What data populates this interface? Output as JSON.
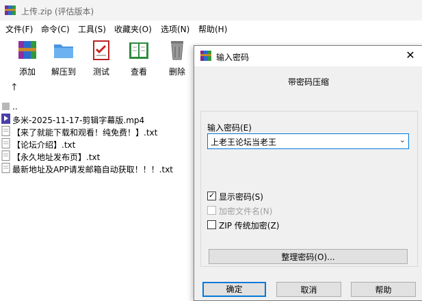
{
  "window": {
    "title": "上传.zip (评估版本)"
  },
  "menu": [
    "文件(F)",
    "命令(C)",
    "工具(S)",
    "收藏夹(O)",
    "选项(N)",
    "帮助(H)"
  ],
  "toolbar": {
    "add": "添加",
    "extract": "解压到",
    "test": "测试",
    "view": "查看",
    "delete": "删除"
  },
  "files": [
    "..",
    "多米-2025-11-17-剪辑字幕版.mp4",
    "【来了就能下载和观看！纯免费！】.txt",
    "【论坛介绍】.txt",
    "【永久地址发布页】.txt",
    "最新地址及APP请发邮箱自动获取！！！.txt"
  ],
  "dialog": {
    "title": "输入密码",
    "subtitle": "带密码压缩",
    "password_label": "输入密码(E)",
    "password_value": "上老王论坛当老王",
    "show_password": "显示密码(S)",
    "encrypt_filenames": "加密文件名(N)",
    "zip_legacy": "ZIP 传统加密(Z)",
    "organize": "整理密码(O)...",
    "ok": "确定",
    "cancel": "取消",
    "help": "帮助",
    "show_password_checked": true,
    "encrypt_filenames_enabled": false
  }
}
